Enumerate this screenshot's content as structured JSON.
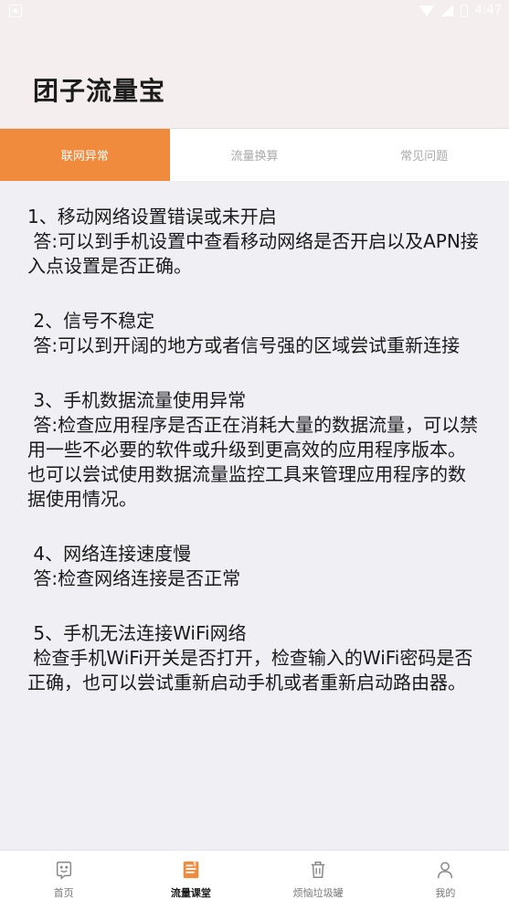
{
  "status_bar": {
    "time": "4:47"
  },
  "header": {
    "title": "团子流量宝"
  },
  "tabs": [
    {
      "label": "联网异常",
      "active": true
    },
    {
      "label": "流量换算",
      "active": false
    },
    {
      "label": "常见问题",
      "active": false
    }
  ],
  "faq": [
    {
      "question": "1、移动网络设置错误或未开启",
      "answer": " 答:可以到手机设置中查看移动网络是否开启以及APN接入点设置是否正确。"
    },
    {
      "question": " 2、信号不稳定",
      "answer": " 答:可以到开阔的地方或者信号强的区域尝试重新连接"
    },
    {
      "question": " 3、手机数据流量使用异常",
      "answer": " 答:检查应用程序是否正在消耗大量的数据流量，可以禁用一些不必要的软件或升级到更高效的应用程序版本。也可以尝试使用数据流量监控工具来管理应用程序的数据使用情况。"
    },
    {
      "question": " 4、网络连接速度慢",
      "answer": " 答:检查网络连接是否正常"
    },
    {
      "question": " 5、手机无法连接WiFi网络",
      "answer": " 检查手机WiFi开关是否打开，检查输入的WiFi密码是否正确，也可以尝试重新启动手机或者重新启动路由器。"
    }
  ],
  "bottom_nav": [
    {
      "label": "首页",
      "icon": "smile-icon",
      "active": false
    },
    {
      "label": "流量课堂",
      "icon": "book-icon",
      "active": true
    },
    {
      "label": "烦恼垃圾罐",
      "icon": "trash-icon",
      "active": false
    },
    {
      "label": "我的",
      "icon": "user-icon",
      "active": false
    }
  ],
  "colors": {
    "accent": "#f08a3c",
    "header_bg": "#f5eeee",
    "content_bg": "#efeff4"
  }
}
